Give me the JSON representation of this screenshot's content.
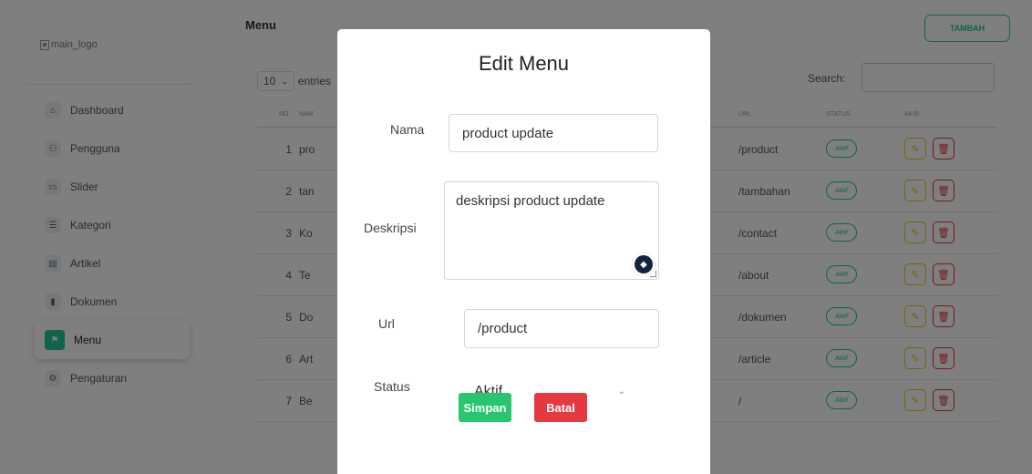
{
  "sidebar": {
    "logo_alt": "main_logo",
    "items": [
      {
        "label": "Dashboard",
        "icon": "home-icon",
        "glyph": "⌂"
      },
      {
        "label": "Pengguna",
        "icon": "users-icon",
        "glyph": "⚇"
      },
      {
        "label": "Slider",
        "icon": "image-icon",
        "glyph": "▭"
      },
      {
        "label": "Kategori",
        "icon": "list-icon",
        "glyph": "☰"
      },
      {
        "label": "Artikel",
        "icon": "article-icon",
        "glyph": "▤"
      },
      {
        "label": "Dokumen",
        "icon": "document-icon",
        "glyph": "▮"
      },
      {
        "label": "Menu",
        "icon": "flag-icon",
        "glyph": "⚑",
        "active": true
      },
      {
        "label": "Pengaturan",
        "icon": "settings-icon",
        "glyph": "⚙"
      }
    ]
  },
  "main": {
    "title": "Menu",
    "add_button": "TAMBAH",
    "entries_value": "10",
    "entries_label": "entries",
    "search_label": "Search:",
    "table": {
      "columns": {
        "no": "NO",
        "name": "NAM",
        "url": "URL",
        "status": "STATUS",
        "action": "AKSI"
      },
      "rows": [
        {
          "no": "1",
          "name": "pro",
          "url": "/product",
          "status": "Aktif"
        },
        {
          "no": "2",
          "name": "tan",
          "url": "/tambahan",
          "status": "Aktif"
        },
        {
          "no": "3",
          "name": "Ko",
          "url": "/contact",
          "status": "Aktif"
        },
        {
          "no": "4",
          "name": "Te",
          "url": "/about",
          "status": "Aktif"
        },
        {
          "no": "5",
          "name": "Do",
          "url": "/dokumen",
          "status": "Aktif"
        },
        {
          "no": "6",
          "name": "Art",
          "url": "/article",
          "status": "Aktif"
        },
        {
          "no": "7",
          "name": "Be",
          "url": "/",
          "status": "Aktif"
        }
      ]
    }
  },
  "modal": {
    "title": "Edit Menu",
    "fields": {
      "name_label": "Nama",
      "name_value": "product update",
      "desc_label": "Deskripsi",
      "desc_value": "deskripsi product update",
      "url_label": "Url",
      "url_value": "/product",
      "status_label": "Status",
      "status_value": "Aktif"
    },
    "save_label": "Simpan",
    "cancel_label": "Batal"
  },
  "colors": {
    "accent": "#20c997",
    "save": "#28c76f",
    "cancel": "#e53840",
    "edit": "#f0c419",
    "delete": "#e53935"
  }
}
